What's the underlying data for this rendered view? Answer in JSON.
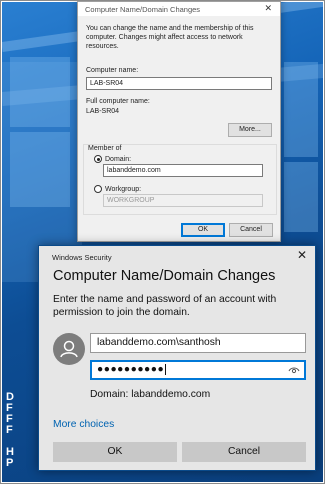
{
  "dialog_main": {
    "title": "Computer Name/Domain Changes",
    "description": "You can change the name and the membership of this computer. Changes might affect access to network resources.",
    "computer_name_label": "Computer name:",
    "computer_name_value": "LAB-SR04",
    "full_name_label": "Full computer name:",
    "full_name_value": "LAB-SR04",
    "more_button": "More...",
    "member_of_label": "Member of",
    "domain_label": "Domain:",
    "domain_value": "labanddemo.com",
    "workgroup_label": "Workgroup:",
    "workgroup_value": "WORKGROUP",
    "selected_membership": "Domain",
    "ok_button": "OK",
    "cancel_button": "Cancel"
  },
  "security_dialog": {
    "caption": "Windows Security",
    "title": "Computer Name/Domain Changes",
    "instruction": "Enter the name and password of an account with permission to join the domain.",
    "username_value": "labanddemo.com\\santhosh",
    "password_masked": "●●●●●●●●●●",
    "domain_text": "Domain: labanddemo.com",
    "more_choices_link": "More choices",
    "ok_button": "OK",
    "cancel_button": "Cancel",
    "accent_color": "#0078d7",
    "link_color": "#0063b1"
  },
  "icons": {
    "close": "close-icon",
    "avatar": "user-avatar-icon",
    "reveal_password": "eye-icon"
  }
}
